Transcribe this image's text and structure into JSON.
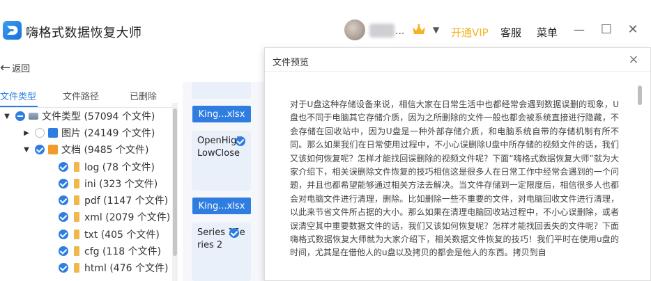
{
  "app": {
    "title": "嗨格式数据恢复大师"
  },
  "header": {
    "user_name_suffix": "...",
    "vip_label": "开通VIP",
    "service_label": "客服",
    "menu_label": "菜单",
    "minimize_symbol": "—",
    "maximize_symbol": "☐",
    "close_symbol": "✕",
    "colors": {
      "vip": "#f2b31c",
      "accent": "#2f7de1"
    }
  },
  "nav": {
    "back_label": "返回"
  },
  "tabs": [
    {
      "label": "文件类型",
      "active": true
    },
    {
      "label": "文件路径",
      "active": false
    },
    {
      "label": "已删除",
      "active": false
    }
  ],
  "tree": [
    {
      "label": "文件类型 (57094 个文件)",
      "toggle": "▼",
      "check": "part",
      "icon": "drive-icon",
      "level": 0
    },
    {
      "label": "图片 (24149 个文件)",
      "toggle": "▶",
      "check": "off",
      "icon": "image-folder-icon",
      "level": 1
    },
    {
      "label": "文档 (9485 个文件)",
      "toggle": "▼",
      "check": "on",
      "icon": "document-folder-icon",
      "level": 1
    },
    {
      "label": "log (78 个文件)",
      "toggle": "",
      "check": "on",
      "icon": "file-icon",
      "level": 2
    },
    {
      "label": "ini (323 个文件)",
      "toggle": "",
      "check": "on",
      "icon": "file-icon",
      "level": 2
    },
    {
      "label": "pdf (1147 个文件)",
      "toggle": "",
      "check": "on",
      "icon": "file-icon",
      "level": 2
    },
    {
      "label": "xml (2079 个文件)",
      "toggle": "",
      "check": "on",
      "icon": "file-icon",
      "level": 2
    },
    {
      "label": "txt (405 个文件)",
      "toggle": "",
      "check": "on",
      "icon": "file-icon",
      "level": 2
    },
    {
      "label": "cfg (118 个文件)",
      "toggle": "",
      "check": "on",
      "icon": "file-icon",
      "level": 2
    },
    {
      "label": "html (476 个文件)",
      "toggle": "",
      "check": "on",
      "icon": "file-icon",
      "level": 2
    }
  ],
  "files": {
    "name_1": "King...xlsx",
    "card_1": "OpenHighLowClose",
    "name_2": "King...xlsx",
    "card_2": "Series 1Series 2"
  },
  "preview": {
    "title": "文件预览",
    "close_symbol": "×",
    "text": "对于U盘这种存储设备来说，相信大家在日常生活中也都经常会遇到数据误删的现象，U盘也不同于电脑其它存储介质，因为之所删除的文件一般也都会被系统直接进行隐藏，不会存储在回收站中，因为U盘是一种外部存储介质，和电脑系统自带的存储机制有所不同。那么如果我们在日常使用过程中，不小心误删除U盘中所存储的视频文件的话，我们又该如何恢复呢？怎样才能找回误删除的视频文件呢？下面“嗨格式数据恢复大师”就为大家介绍下，相关误删除文件恢复的技巧相信这是很多人在日常工作中经常会遇到的一个问题，并且也都希望能够通过相关方法去解决。当文件存储到一定限度后，相信很多人也都会对电脑文件进行清理，删除。比如删除一些不重要的文件，对电脑回收文件进行清理，以此来节省文件所占据的大小。那么如果在清理电脑回收站过程中，不小心误删除，或者误清空其中重要数据文件的话，我们又该如何恢复呢？怎样才能找回丢失的文件呢？下面嗨格式数据恢复大师就为大家介绍下，相关数据文件恢复的技巧！我们平时在使用u盘的时间，尤其是在借他人的u盘以及拷贝的都会是他人的东西。拷贝到自"
  }
}
